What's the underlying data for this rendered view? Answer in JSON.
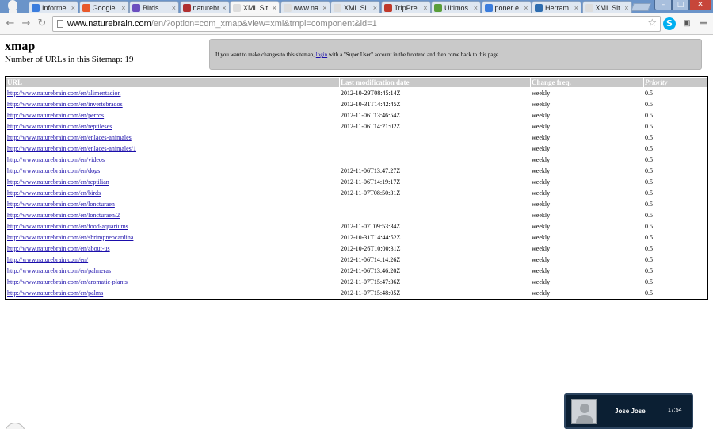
{
  "browser": {
    "tabs": [
      {
        "label": "Informe",
        "favicon_color": "#3b7ddd"
      },
      {
        "label": "Google",
        "favicon_color": "#e8592a"
      },
      {
        "label": "Birds",
        "favicon_color": "#6b4fbf"
      },
      {
        "label": "naturebr",
        "favicon_color": "#b03030"
      },
      {
        "label": "XML Sit",
        "favicon_color": "#dddddd",
        "active": true
      },
      {
        "label": "www.na",
        "favicon_color": "#dddddd"
      },
      {
        "label": "XML Si",
        "favicon_color": "#dddddd"
      },
      {
        "label": "TripPre",
        "favicon_color": "#c0392b"
      },
      {
        "label": "Ultimos",
        "favicon_color": "#5a9e3a"
      },
      {
        "label": "poner e",
        "favicon_color": "#3b7ddd"
      },
      {
        "label": "Herram",
        "favicon_color": "#2e6db0"
      },
      {
        "label": "XML Sit",
        "favicon_color": "#dddddd"
      }
    ],
    "url_host": "www.naturebrain.com",
    "url_rest": "/en/?option=com_xmap&view=xml&tmpl=component&id=1"
  },
  "page": {
    "title": "xmap",
    "url_count_text": "Number of URLs in this Sitemap: 19",
    "notice_before": "If you want to make changes to this sitemap, ",
    "notice_link": "login",
    "notice_after": " with a \"Super User\" account in the frontend and then come back to this page."
  },
  "table": {
    "headers": [
      "URL",
      "Last modification date",
      "Change freq.",
      "Priority"
    ],
    "rows": [
      {
        "url": "http://www.naturebrain.com/en/alimentacion",
        "date": "2012-10-29T08:45:14Z",
        "freq": "weekly",
        "priority": "0.5"
      },
      {
        "url": "http://www.naturebrain.com/en/invertebrados",
        "date": "2012-10-31T14:42:45Z",
        "freq": "weekly",
        "priority": "0.5"
      },
      {
        "url": "http://www.naturebrain.com/en/perros",
        "date": "2012-11-06T13:46:54Z",
        "freq": "weekly",
        "priority": "0.5"
      },
      {
        "url": "http://www.naturebrain.com/en/reptileses",
        "date": "2012-11-06T14:21:02Z",
        "freq": "weekly",
        "priority": "0.5"
      },
      {
        "url": "http://www.naturebrain.com/en/enlaces-animales",
        "date": "",
        "freq": "weekly",
        "priority": "0.5"
      },
      {
        "url": "http://www.naturebrain.com/en/enlaces-animales/1",
        "date": "",
        "freq": "weekly",
        "priority": "0.5"
      },
      {
        "url": "http://www.naturebrain.com/en/videos",
        "date": "",
        "freq": "weekly",
        "priority": "0.5"
      },
      {
        "url": "http://www.naturebrain.com/en/dogs",
        "date": "2012-11-06T13:47:27Z",
        "freq": "weekly",
        "priority": "0.5"
      },
      {
        "url": "http://www.naturebrain.com/en/reptilian",
        "date": "2012-11-06T14:19:17Z",
        "freq": "weekly",
        "priority": "0.5"
      },
      {
        "url": "http://www.naturebrain.com/en/birds",
        "date": "2012-11-07T08:50:31Z",
        "freq": "weekly",
        "priority": "0.5"
      },
      {
        "url": "http://www.naturebrain.com/en/loncturaen",
        "date": "",
        "freq": "weekly",
        "priority": "0.5"
      },
      {
        "url": "http://www.naturebrain.com/en/loncturaen/2",
        "date": "",
        "freq": "weekly",
        "priority": "0.5"
      },
      {
        "url": "http://www.naturebrain.com/en/food-aquariums",
        "date": "2012-11-07T09:53:34Z",
        "freq": "weekly",
        "priority": "0.5"
      },
      {
        "url": "http://www.naturebrain.com/en/shrimpneocardina",
        "date": "2012-10-31T14:44:52Z",
        "freq": "weekly",
        "priority": "0.5"
      },
      {
        "url": "http://www.naturebrain.com/en/about-us",
        "date": "2012-10-26T10:00:31Z",
        "freq": "weekly",
        "priority": "0.5"
      },
      {
        "url": "http://www.naturebrain.com/en/",
        "date": "2012-11-06T14:14:26Z",
        "freq": "weekly",
        "priority": "0.5"
      },
      {
        "url": "http://www.naturebrain.com/en/palmeras",
        "date": "2012-11-06T13:46:20Z",
        "freq": "weekly",
        "priority": "0.5"
      },
      {
        "url": "http://www.naturebrain.com/en/aromatic-plants",
        "date": "2012-11-07T15:47:36Z",
        "freq": "weekly",
        "priority": "0.5"
      },
      {
        "url": "http://www.naturebrain.com/en/palms",
        "date": "2012-11-07T15:48:05Z",
        "freq": "weekly",
        "priority": "0.5"
      }
    ]
  },
  "chat": {
    "name": "Jose Jose",
    "time": "17:54"
  },
  "colors": {
    "tabstrip": "#6b94c9",
    "header_bg": "#c8c8c8",
    "link": "#1a0dab",
    "notice_bg": "#c9c9c9",
    "chat_bg": "#0b1f33"
  },
  "icons": {
    "back": "back-arrow-icon",
    "forward": "forward-arrow-icon",
    "reload": "reload-icon",
    "star": "bookmark-star-icon",
    "skype": "skype-icon",
    "extension": "extension-icon",
    "menu": "menu-icon"
  }
}
